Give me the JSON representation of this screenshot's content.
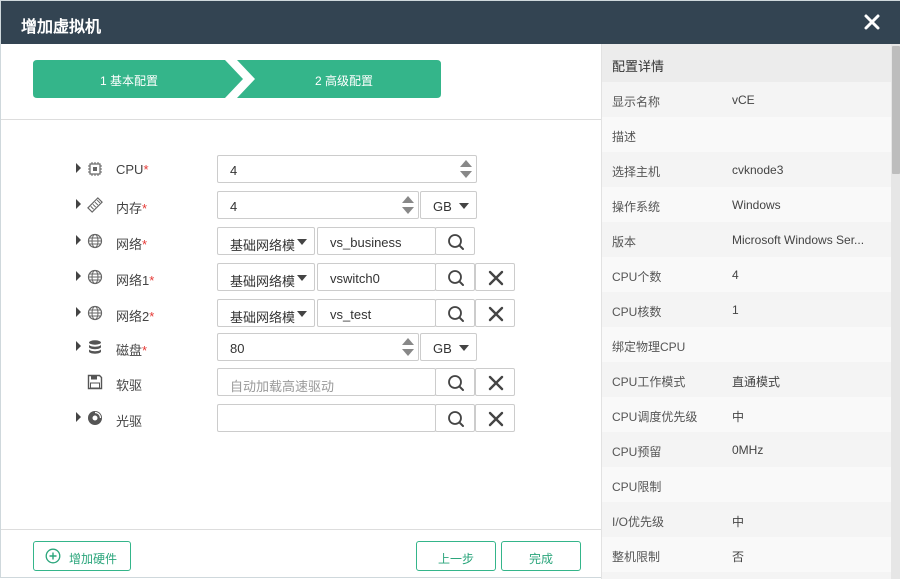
{
  "dialog": {
    "title": "增加虚拟机",
    "close_icon": "close-icon"
  },
  "steps": [
    {
      "label": "1 基本配置",
      "color": "#34b58a"
    },
    {
      "label": "2 高级配置",
      "color": "#34b58a"
    }
  ],
  "form": {
    "cpu": {
      "label": "CPU",
      "required": "*",
      "value": "4"
    },
    "memory": {
      "label": "内存",
      "required": "*",
      "value": "4",
      "unit": "GB"
    },
    "network": {
      "label": "网络",
      "required": "*",
      "type": "基础网络模",
      "value": "vs_business"
    },
    "network1": {
      "label": "网络1",
      "required": "*",
      "type": "基础网络模",
      "value": "vswitch0"
    },
    "network2": {
      "label": "网络2",
      "required": "*",
      "type": "基础网络模",
      "value": "vs_test"
    },
    "disk": {
      "label": "磁盘",
      "required": "*",
      "value": "80",
      "unit": "GB"
    },
    "floppy": {
      "label": "软驱",
      "placeholder": "自动加载高速驱动"
    },
    "cdrom": {
      "label": "光驱",
      "value": ""
    }
  },
  "footer": {
    "add_hardware": "增加硬件",
    "prev": "上一步",
    "finish": "完成"
  },
  "details": {
    "title": "配置详情",
    "rows": [
      {
        "k": "显示名称",
        "v": "vCE"
      },
      {
        "k": "描述",
        "v": ""
      },
      {
        "k": "选择主机",
        "v": "cvknode3"
      },
      {
        "k": "操作系统",
        "v": "Windows"
      },
      {
        "k": "版本",
        "v": "Microsoft Windows Ser..."
      },
      {
        "k": "CPU个数",
        "v": "4"
      },
      {
        "k": "CPU核数",
        "v": "1"
      },
      {
        "k": "绑定物理CPU",
        "v": ""
      },
      {
        "k": "CPU工作模式",
        "v": "直通模式"
      },
      {
        "k": "CPU调度优先级",
        "v": "中"
      },
      {
        "k": "CPU预留",
        "v": "0MHz"
      },
      {
        "k": "CPU限制",
        "v": ""
      },
      {
        "k": "I/O优先级",
        "v": "中"
      },
      {
        "k": "整机限制",
        "v": "否"
      }
    ]
  }
}
